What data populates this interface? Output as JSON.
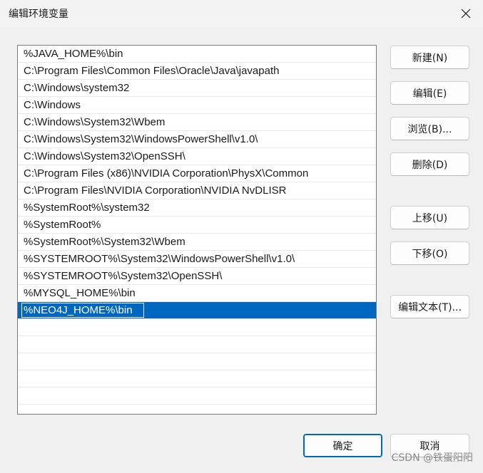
{
  "window": {
    "title": "编辑环境变量",
    "close_icon": "close-icon"
  },
  "list": {
    "items": [
      "%JAVA_HOME%\\bin",
      "C:\\Program Files\\Common Files\\Oracle\\Java\\javapath",
      "C:\\Windows\\system32",
      "C:\\Windows",
      "C:\\Windows\\System32\\Wbem",
      "C:\\Windows\\System32\\WindowsPowerShell\\v1.0\\",
      "C:\\Windows\\System32\\OpenSSH\\",
      "C:\\Program Files (x86)\\NVIDIA Corporation\\PhysX\\Common",
      "C:\\Program Files\\NVIDIA Corporation\\NVIDIA NvDLISR",
      "%SystemRoot%\\system32",
      "%SystemRoot%",
      "%SystemRoot%\\System32\\Wbem",
      "%SYSTEMROOT%\\System32\\WindowsPowerShell\\v1.0\\",
      "%SYSTEMROOT%\\System32\\OpenSSH\\",
      "%MYSQL_HOME%\\bin"
    ],
    "editing_value": "%NEO4J_HOME%\\bin"
  },
  "buttons": {
    "new": "新建(N)",
    "edit": "编辑(E)",
    "browse": "浏览(B)...",
    "delete": "删除(D)",
    "move_up": "上移(U)",
    "move_down": "下移(O)",
    "edit_text": "编辑文本(T)...",
    "ok": "确定",
    "cancel": "取消"
  },
  "watermark": "CSDN @铁蛋阳阳",
  "colors": {
    "selection": "#0067c0",
    "background": "#f0f0f0"
  }
}
